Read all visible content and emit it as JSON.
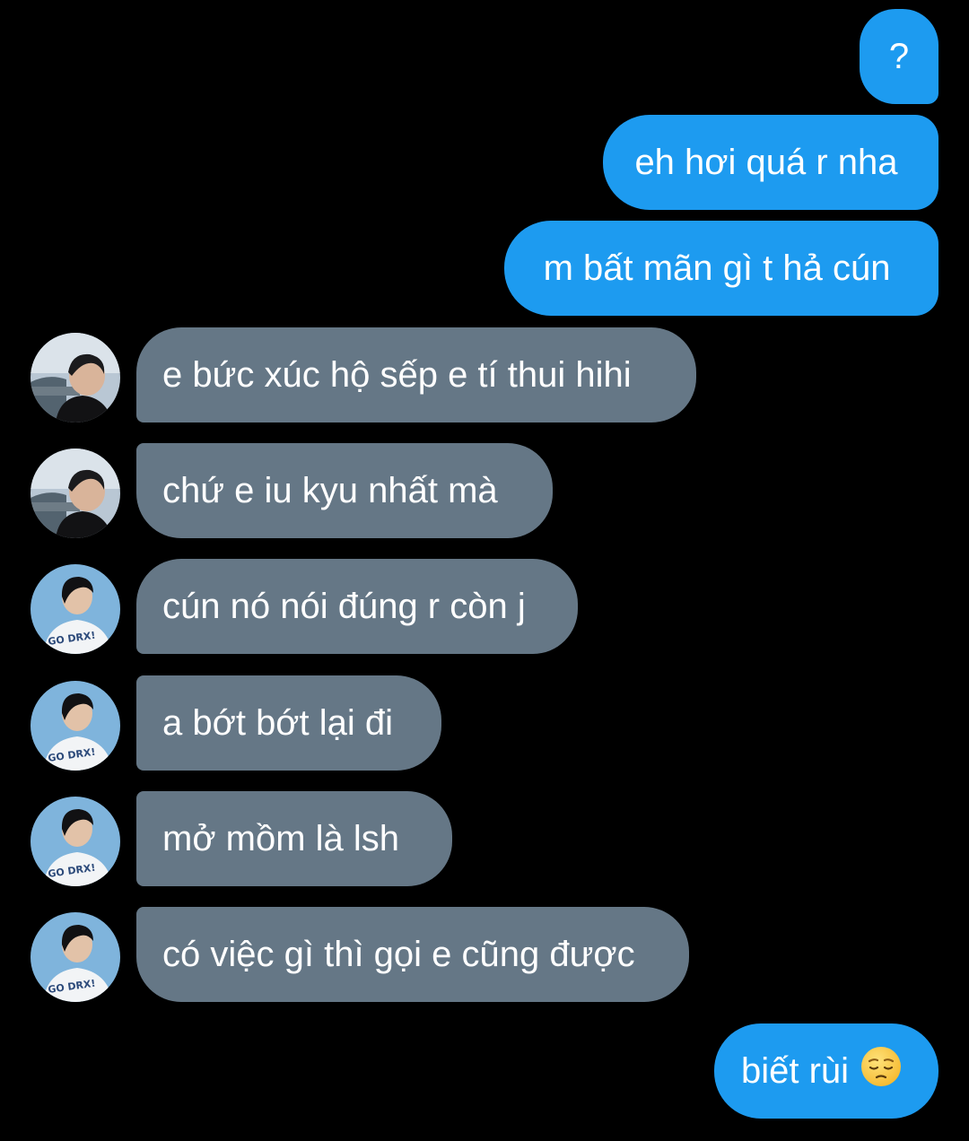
{
  "conversation": {
    "messages": [
      {
        "text": "?"
      },
      {
        "text": "eh hơi quá r nha"
      },
      {
        "text": "m bất mãn gì t hả cún"
      },
      {
        "text": "e bức xúc hộ sếp e tí thui hihi"
      },
      {
        "text": "chứ e iu kyu nhất mà"
      },
      {
        "text": "cún nó nói đúng r còn j"
      },
      {
        "text": "a bớt bớt lại đi"
      },
      {
        "text": "mở mồm là lsh"
      },
      {
        "text": "có việc gì thì gọi e cũng được"
      },
      {
        "text": "biết rùi"
      }
    ]
  },
  "emoji": {
    "name": "pensive-face-emoji"
  },
  "colors": {
    "background": "#000000",
    "sent_bubble": "#1d9bf0",
    "received_bubble": "#657786",
    "text": "#ffffff"
  },
  "avatars": {
    "user_a": {
      "name": "user-a-avatar",
      "shirt_text": "GO DRX!"
    },
    "user_b": {
      "name": "user-b-avatar"
    }
  }
}
